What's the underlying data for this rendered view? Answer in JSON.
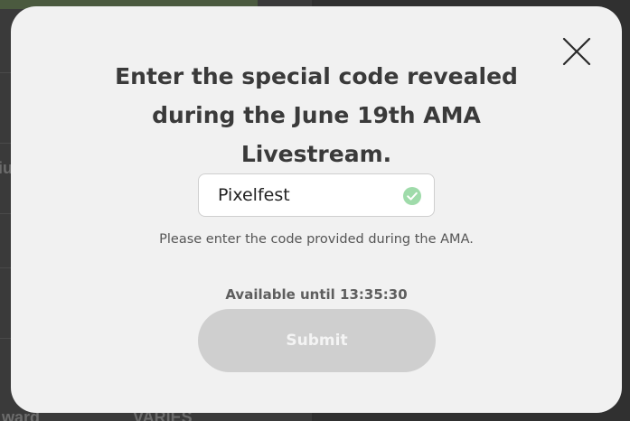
{
  "modal": {
    "title": "Enter the special code revealed during the June 19th AMA Livestream.",
    "code_value": "Pixelfest",
    "helper_text": "Please enter the code provided during the AMA.",
    "availability": "Available until 13:35:30",
    "submit_label": "Submit",
    "icons": {
      "close": "close-icon",
      "valid": "check-circle-icon"
    },
    "colors": {
      "valid": "#9fdbaa",
      "submit_disabled": "#cfcfcf",
      "title": "#3a3a3a"
    }
  },
  "background": {
    "left_fragment": "iu",
    "bottom_left": "ward",
    "bottom_right": "VARIES"
  }
}
